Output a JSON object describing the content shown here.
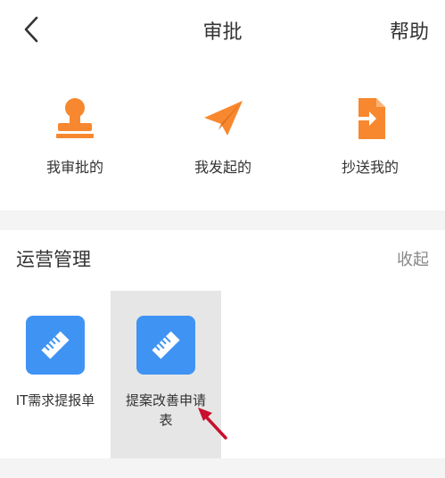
{
  "header": {
    "title": "审批",
    "help": "帮助"
  },
  "shortcuts": [
    {
      "label": "我审批的",
      "icon": "stamp-icon"
    },
    {
      "label": "我发起的",
      "icon": "paper-plane-icon"
    },
    {
      "label": "抄送我的",
      "icon": "document-arrow-icon"
    }
  ],
  "section": {
    "title": "运营管理",
    "collapse": "收起",
    "apps": [
      {
        "label": "IT需求提报单",
        "icon": "ruler-icon"
      },
      {
        "label": "提案改善申请表",
        "icon": "ruler-icon",
        "selected": true
      }
    ]
  },
  "colors": {
    "orange": "#f7882f",
    "blue": "#3f93f3",
    "annotation_red": "#c8102e"
  }
}
